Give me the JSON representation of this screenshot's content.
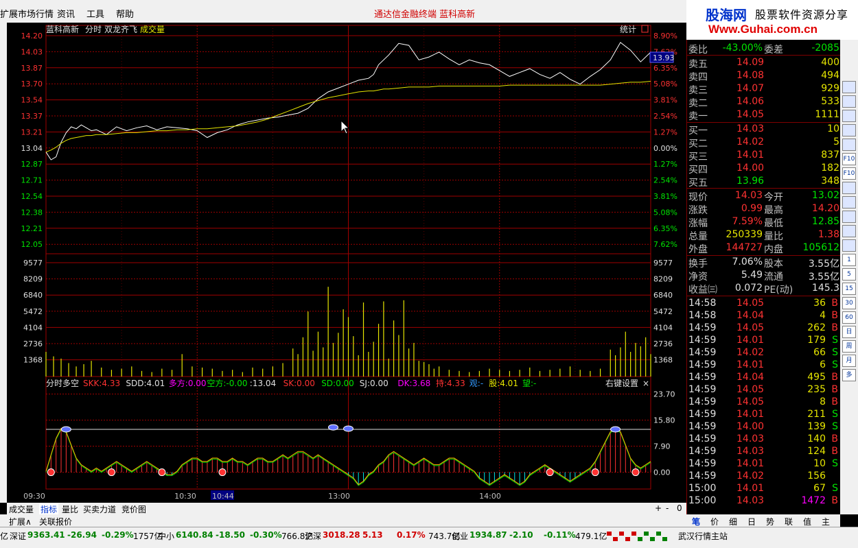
{
  "menu": {
    "items": [
      "扩展市场行情",
      "资讯",
      "工具",
      "帮助"
    ],
    "title": "通达信金融终端    蓝科高新"
  },
  "banner": {
    "logo": "股海网",
    "slogan": "股票软件资源分享",
    "url": "Www.Guhai.com.cn"
  },
  "chart_data": [
    {
      "type": "line",
      "title": "蓝科高新  分时  双龙齐飞  成交量",
      "corner_label": "统计",
      "price_ticks": [
        "14.20",
        "14.03",
        "13.87",
        "13.70",
        "13.54",
        "13.37",
        "13.21",
        "13.04",
        "12.87",
        "12.71",
        "12.54",
        "12.38",
        "12.21",
        "12.05"
      ],
      "pct_ticks": [
        "8.90%",
        "7.62%",
        "6.35%",
        "5.08%",
        "3.81%",
        "2.54%",
        "1.27%",
        "0.00%",
        "1.27%",
        "2.54%",
        "3.81%",
        "5.08%",
        "6.35%",
        "7.62%"
      ],
      "current_price_label": "13.93",
      "ylim": [
        12.05,
        14.2
      ],
      "x": [
        0,
        2,
        4,
        6,
        8,
        10,
        12,
        14,
        16,
        18,
        20,
        24,
        28,
        32,
        36,
        40,
        44,
        48,
        52,
        56,
        60,
        64,
        68,
        72,
        76,
        80,
        84,
        88,
        92,
        96,
        100,
        104,
        108,
        112,
        116,
        120,
        124,
        128,
        130,
        132,
        134,
        136,
        140,
        144,
        148,
        152,
        156,
        160,
        164,
        168,
        172,
        176,
        180,
        184,
        188,
        192,
        196,
        200,
        204,
        208,
        212,
        216,
        220,
        224,
        228,
        232,
        236,
        240
      ],
      "series": [
        {
          "values": [
            13.0,
            12.92,
            12.95,
            13.1,
            13.2,
            13.26,
            13.24,
            13.28,
            13.25,
            13.22,
            13.23,
            13.18,
            13.26,
            13.22,
            13.25,
            13.27,
            13.23,
            13.26,
            13.25,
            13.24,
            13.22,
            13.15,
            13.2,
            13.23,
            13.28,
            13.31,
            13.33,
            13.35,
            13.36,
            13.38,
            13.4,
            13.45,
            13.55,
            13.62,
            13.66,
            13.7,
            13.74,
            13.76,
            13.8,
            13.9,
            13.95,
            14.0,
            14.12,
            14.1,
            13.95,
            13.98,
            14.03,
            13.96,
            13.9,
            13.95,
            13.92,
            13.9,
            13.84,
            13.78,
            13.82,
            13.86,
            13.8,
            13.76,
            13.82,
            13.75,
            13.7,
            13.78,
            13.85,
            13.95,
            14.13,
            14.05,
            13.93,
            14.03
          ]
        },
        {
          "values": [
            13.0,
            13.02,
            13.05,
            13.09,
            13.12,
            13.14,
            13.15,
            13.16,
            13.17,
            13.17,
            13.18,
            13.18,
            13.19,
            13.2,
            13.2,
            13.21,
            13.22,
            13.22,
            13.23,
            13.23,
            13.24,
            13.24,
            13.25,
            13.26,
            13.27,
            13.29,
            13.31,
            13.34,
            13.38,
            13.42,
            13.46,
            13.5,
            13.53,
            13.56,
            13.58,
            13.6,
            13.62,
            13.63,
            13.63,
            13.64,
            13.65,
            13.65,
            13.66,
            13.67,
            13.67,
            13.67,
            13.68,
            13.68,
            13.68,
            13.68,
            13.68,
            13.68,
            13.68,
            13.69,
            13.69,
            13.69,
            13.69,
            13.69,
            13.69,
            13.69,
            13.69,
            13.69,
            13.69,
            13.7,
            13.71,
            13.72,
            13.72,
            13.73
          ]
        }
      ]
    },
    {
      "type": "bar",
      "title": "成交量",
      "volume_ticks": [
        "9577",
        "8209",
        "6840",
        "5472",
        "4104",
        "2736",
        "1368"
      ],
      "ylim": [
        0,
        10946
      ],
      "x": [
        0,
        3,
        6,
        9,
        12,
        15,
        18,
        22,
        26,
        30,
        34,
        38,
        42,
        46,
        50,
        54,
        58,
        62,
        66,
        70,
        74,
        78,
        82,
        86,
        90,
        94,
        98,
        100,
        102,
        104,
        106,
        108,
        110,
        112,
        114,
        116,
        118,
        120,
        122,
        124,
        126,
        128,
        130,
        132,
        134,
        136,
        138,
        140,
        142,
        144,
        146,
        148,
        150,
        152,
        154,
        156,
        160,
        164,
        168,
        172,
        176,
        180,
        184,
        188,
        192,
        196,
        200,
        204,
        208,
        212,
        216,
        220,
        224,
        226,
        228,
        230,
        232,
        234,
        236,
        238,
        240
      ],
      "values": [
        2200,
        1800,
        1600,
        1200,
        900,
        1100,
        1400,
        800,
        600,
        700,
        900,
        500,
        400,
        700,
        600,
        2000,
        900,
        800,
        700,
        500,
        600,
        400,
        800,
        700,
        900,
        1200,
        2500,
        2000,
        3500,
        5800,
        2300,
        4000,
        2600,
        8000,
        3000,
        3900,
        6000,
        5300,
        3600,
        1900,
        6600,
        2200,
        3100,
        4700,
        6700,
        1600,
        5000,
        3700,
        6800,
        2500,
        3000,
        1400,
        1300,
        1100,
        700,
        900,
        600,
        500,
        400,
        500,
        700,
        600,
        500,
        600,
        800,
        500,
        600,
        700,
        900,
        600,
        500,
        700,
        2400,
        1900,
        2600,
        4000,
        2200,
        3000,
        2700,
        3500,
        2000
      ]
    },
    {
      "type": "line",
      "title": "分时多空",
      "legend": [
        {
          "name": "SKK:",
          "value": "4.33",
          "color": "#ff3232"
        },
        {
          "name": "SDD:",
          "value": "4.01",
          "color": "#e0e0e0"
        },
        {
          "name": "多方:",
          "value": "0.00",
          "color": "#ff00ff"
        },
        {
          "name": "空方:",
          "value": "-0.00",
          "color": "#00e600"
        },
        {
          "name": ":",
          "value": "13.04",
          "color": "#e0e0e0"
        },
        {
          "name": "SK:",
          "value": "0.00",
          "color": "#ff3232"
        },
        {
          "name": "SD:",
          "value": "0.00",
          "color": "#00e600"
        },
        {
          "name": "SJ:",
          "value": "0.00",
          "color": "#e0e0e0"
        },
        {
          "name": "DK:",
          "value": "3.68",
          "color": "#ff00ff"
        },
        {
          "name": "持:",
          "value": "4.33",
          "color": "#ff3232"
        },
        {
          "name": "观:",
          "value": "-",
          "color": "#3399ff"
        },
        {
          "name": "股:",
          "value": "4.01",
          "color": "#e6e600"
        },
        {
          "name": "望:",
          "value": "-",
          "color": "#00e600"
        }
      ],
      "corner_label": "右键设置",
      "ticks": [
        "23.70",
        "15.80",
        "7.90",
        "0.00"
      ],
      "ylim": [
        -3,
        24
      ],
      "x": [
        0,
        2,
        4,
        6,
        8,
        10,
        12,
        14,
        16,
        18,
        20,
        22,
        24,
        26,
        28,
        30,
        32,
        34,
        36,
        38,
        40,
        42,
        44,
        46,
        48,
        50,
        52,
        54,
        56,
        58,
        60,
        62,
        64,
        66,
        68,
        70,
        72,
        74,
        76,
        78,
        80,
        82,
        84,
        86,
        88,
        90,
        92,
        94,
        96,
        98,
        100,
        102,
        104,
        106,
        108,
        110,
        112,
        114,
        116,
        118,
        120,
        122,
        124,
        126,
        128,
        130,
        132,
        134,
        136,
        138,
        140,
        142,
        144,
        146,
        148,
        150,
        152,
        154,
        156,
        158,
        160,
        162,
        164,
        166,
        168,
        170,
        172,
        174,
        176,
        178,
        180,
        182,
        184,
        186,
        188,
        190,
        192,
        194,
        196,
        198,
        200,
        202,
        204,
        206,
        208,
        210,
        212,
        214,
        216,
        218,
        220,
        222,
        224,
        226,
        228,
        230,
        232,
        234,
        236,
        238,
        240
      ],
      "values": [
        0,
        5,
        10,
        13,
        12,
        8,
        4,
        2,
        1,
        0,
        1,
        0,
        1,
        2,
        3,
        2,
        1,
        0,
        1,
        2,
        3,
        2,
        1,
        0,
        -1,
        -1,
        0,
        2,
        3,
        4,
        4,
        3,
        3,
        4,
        4,
        3,
        3,
        4,
        3,
        3,
        2,
        3,
        4,
        4,
        3,
        3,
        4,
        5,
        4,
        5,
        6,
        6,
        5,
        4,
        5,
        4,
        3,
        2,
        1,
        0,
        -1,
        -2,
        -4,
        -3,
        -1,
        0,
        2,
        3,
        5,
        6,
        5,
        4,
        3,
        2,
        3,
        4,
        3,
        2,
        2,
        3,
        4,
        4,
        3,
        2,
        1,
        0,
        -2,
        -3,
        -4,
        -3,
        -2,
        -1,
        -2,
        -3,
        -4,
        -3,
        -1,
        0,
        1,
        2,
        1,
        0,
        -1,
        -2,
        -3,
        -2,
        -1,
        0,
        1,
        3,
        6,
        9,
        12,
        13,
        12,
        8,
        4,
        2,
        1,
        2,
        3
      ]
    }
  ],
  "time_labels": [
    "09:30",
    "10:30",
    "10:44",
    "13:00",
    "14:00"
  ],
  "quote": {
    "weibi": {
      "label": "委比",
      "value": "-43.00%",
      "label2": "委差",
      "value2": "-2085"
    },
    "sells": [
      {
        "label": "卖五",
        "price": "14.09",
        "vol": "400"
      },
      {
        "label": "卖四",
        "price": "14.08",
        "vol": "494"
      },
      {
        "label": "卖三",
        "price": "14.07",
        "vol": "929"
      },
      {
        "label": "卖二",
        "price": "14.06",
        "vol": "533"
      },
      {
        "label": "卖一",
        "price": "14.05",
        "vol": "1111"
      }
    ],
    "buys": [
      {
        "label": "买一",
        "price": "14.03",
        "vol": "10"
      },
      {
        "label": "买二",
        "price": "14.02",
        "vol": "5"
      },
      {
        "label": "买三",
        "price": "14.01",
        "vol": "837"
      },
      {
        "label": "买四",
        "price": "14.00",
        "vol": "182"
      },
      {
        "label": "买五",
        "price": "13.96",
        "vol": "348"
      }
    ],
    "stats": [
      {
        "l1": "现价",
        "v1": "14.03",
        "c1": "red",
        "l2": "今开",
        "v2": "13.02",
        "c2": "green"
      },
      {
        "l1": "涨跌",
        "v1": "0.99",
        "c1": "red",
        "l2": "最高",
        "v2": "14.20",
        "c2": "red"
      },
      {
        "l1": "涨幅",
        "v1": "7.59%",
        "c1": "red",
        "l2": "最低",
        "v2": "12.85",
        "c2": "green"
      },
      {
        "l1": "总量",
        "v1": "250339",
        "c1": "yellow",
        "l2": "量比",
        "v2": "1.38",
        "c2": "red"
      },
      {
        "l1": "外盘",
        "v1": "144727",
        "c1": "red",
        "l2": "内盘",
        "v2": "105612",
        "c2": "green"
      }
    ],
    "finance": [
      {
        "l1": "换手",
        "v1": "7.06%",
        "l2": "股本",
        "v2": "3.55亿"
      },
      {
        "l1": "净资",
        "v1": "5.49",
        "l2": "流通",
        "v2": "3.55亿"
      },
      {
        "l1": "收益㈢",
        "v1": "0.072",
        "l2": "PE(动)",
        "v2": "145.3"
      }
    ],
    "ticks": [
      {
        "t": "14:58",
        "p": "14.05",
        "pc": "red",
        "v": "36",
        "vc": "yellow",
        "d": "B"
      },
      {
        "t": "14:58",
        "p": "14.04",
        "pc": "red",
        "v": "4",
        "vc": "yellow",
        "d": "B"
      },
      {
        "t": "14:59",
        "p": "14.05",
        "pc": "red",
        "v": "262",
        "vc": "yellow",
        "d": "B"
      },
      {
        "t": "14:59",
        "p": "14.01",
        "pc": "red",
        "v": "179",
        "vc": "yellow",
        "d": "S"
      },
      {
        "t": "14:59",
        "p": "14.02",
        "pc": "red",
        "v": "66",
        "vc": "yellow",
        "d": "S"
      },
      {
        "t": "14:59",
        "p": "14.01",
        "pc": "red",
        "v": "6",
        "vc": "yellow",
        "d": "S"
      },
      {
        "t": "14:59",
        "p": "14.04",
        "pc": "red",
        "v": "495",
        "vc": "yellow",
        "d": "B"
      },
      {
        "t": "14:59",
        "p": "14.05",
        "pc": "red",
        "v": "235",
        "vc": "yellow",
        "d": "B"
      },
      {
        "t": "14:59",
        "p": "14.05",
        "pc": "red",
        "v": "8",
        "vc": "yellow",
        "d": "B"
      },
      {
        "t": "14:59",
        "p": "14.01",
        "pc": "red",
        "v": "211",
        "vc": "yellow",
        "d": "S"
      },
      {
        "t": "14:59",
        "p": "14.00",
        "pc": "red",
        "v": "139",
        "vc": "yellow",
        "d": "S"
      },
      {
        "t": "14:59",
        "p": "14.03",
        "pc": "red",
        "v": "140",
        "vc": "yellow",
        "d": "B"
      },
      {
        "t": "14:59",
        "p": "14.03",
        "pc": "red",
        "v": "124",
        "vc": "yellow",
        "d": "B"
      },
      {
        "t": "14:59",
        "p": "14.01",
        "pc": "red",
        "v": "10",
        "vc": "yellow",
        "d": "S"
      },
      {
        "t": "14:59",
        "p": "14.02",
        "pc": "red",
        "v": "156",
        "vc": "yellow",
        "d": ""
      },
      {
        "t": "15:00",
        "p": "14.01",
        "pc": "red",
        "v": "67",
        "vc": "yellow",
        "d": "S"
      },
      {
        "t": "15:00",
        "p": "14.03",
        "pc": "red",
        "v": "1472",
        "vc": "mag",
        "d": "B"
      }
    ]
  },
  "side_tabs": [
    "笔",
    "价",
    "细",
    "日",
    "势",
    "联",
    "值",
    "主"
  ],
  "side_icons": [
    "rt-icon",
    "bar-icon",
    "line-icon",
    "k-icon",
    "chart-icon",
    "F10",
    "F10",
    "list-icon",
    "grid-icon",
    "news-icon",
    "calc-icon",
    "cal-icon",
    "1",
    "5",
    "15",
    "30",
    "60",
    "日",
    "周",
    "月",
    "多"
  ],
  "bottom_tabs": [
    "成交量",
    "指标",
    "量比",
    "买卖力道",
    "竞价图"
  ],
  "bottom_tabs2": [
    "扩展∧",
    "关联报价"
  ],
  "zoom_controls": [
    "+",
    "-",
    "0"
  ],
  "status": {
    "items": [
      {
        "name": "亿",
        "v": ""
      },
      {
        "name": "深证",
        "v": "9363.41",
        "c": "-26.94",
        "p": "-0.29%",
        "a": "1757亿"
      },
      {
        "name": "中小",
        "v": "6140.84",
        "c": "-18.50",
        "p": "-0.30%",
        "a": "766.8亿"
      },
      {
        "name": "沪深",
        "v": "3018.28",
        "c": "5.13",
        "p": "0.17%",
        "a": "743.7亿"
      },
      {
        "name": "创业",
        "v": "1934.87",
        "c": "-2.10",
        "p": "-0.11%",
        "a": "479.1亿"
      }
    ],
    "server": "武汉行情主站"
  }
}
